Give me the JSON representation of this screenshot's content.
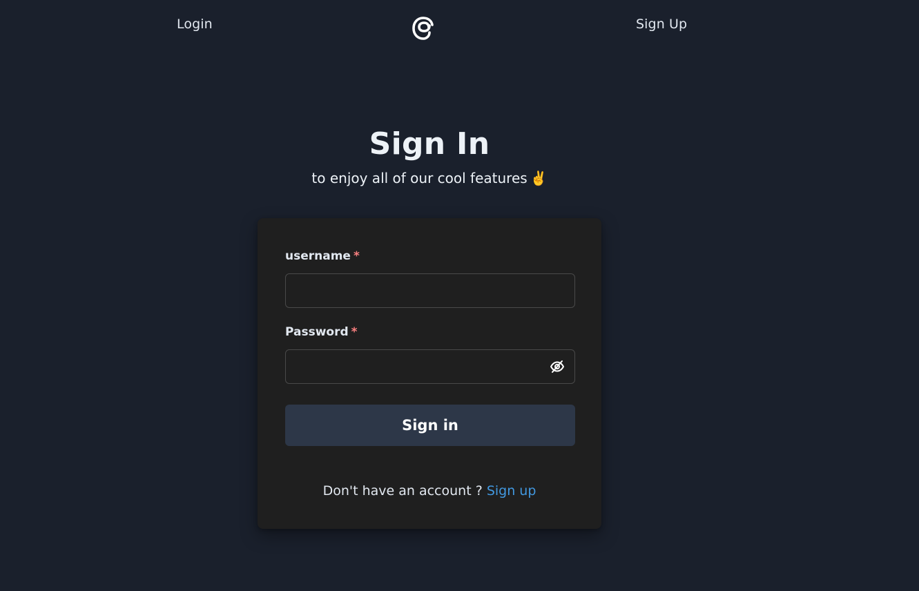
{
  "header": {
    "login_label": "Login",
    "signup_label": "Sign Up",
    "logo_icon": "threads-logo-icon"
  },
  "main": {
    "title": "Sign In",
    "subtitle": "to enjoy all of our cool features",
    "subtitle_emoji": "✌️"
  },
  "form": {
    "username": {
      "label": "username",
      "required_mark": "*",
      "value": "",
      "placeholder": ""
    },
    "password": {
      "label": "Password",
      "required_mark": "*",
      "value": "",
      "placeholder": "",
      "toggle_icon": "eye-slash-icon"
    },
    "submit_label": "Sign in",
    "footer_prefix": "Don't have an account ?",
    "footer_link": "Sign up"
  },
  "colors": {
    "background": "#1a202c",
    "card": "#1f1f1f",
    "button": "#2d3748",
    "required": "#fc8181",
    "link": "#4299e1"
  }
}
